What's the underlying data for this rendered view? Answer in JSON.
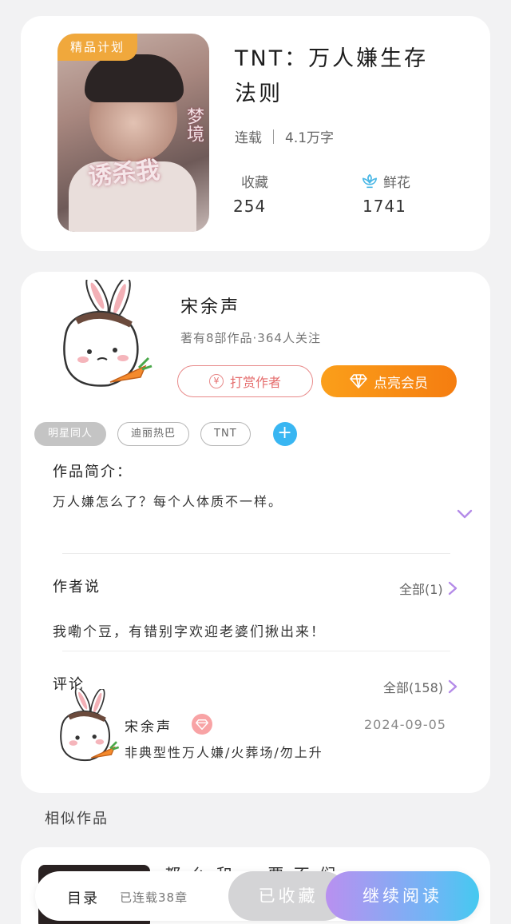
{
  "book": {
    "cover_badge": "精品计划",
    "cover_title": "诱杀我",
    "cover_subtitle": "梦境",
    "title": "TNT：万人嫌生存法则",
    "status": "连载",
    "word_count": "4.1万字",
    "favorites_label": "收藏",
    "favorites_count": "254",
    "flowers_label": "鲜花",
    "flowers_count": "1741"
  },
  "author": {
    "name": "宋余声",
    "stats": "著有8部作品·364人关注",
    "reward_label": "打赏作者",
    "vip_label": "点亮会员"
  },
  "tags": [
    "明星同人",
    "迪丽热巴",
    "TNT"
  ],
  "intro": {
    "heading": "作品简介：",
    "text": "万人嫌怎么了？每个人体质不一样。"
  },
  "author_says": {
    "heading": "作者说",
    "more": "全部(1)",
    "text": "我嘞个豆，有错别字欢迎老婆们揪出来！"
  },
  "comments": {
    "heading": "评论",
    "more": "全部(158)",
    "items": [
      {
        "user": "宋余声",
        "date": "2024-09-05",
        "text": "非典型性万人嫌/火葬场/勿上升"
      }
    ]
  },
  "similar": {
    "heading": "相似作品",
    "first_title": "都 么 和 … 要 不 们 …"
  },
  "bottom_bar": {
    "toc_label": "目录",
    "toc_status": "已连载38章",
    "favorited_label": "已收藏",
    "continue_label": "继续阅读"
  },
  "colors": {
    "accent_orange": "#f57d10",
    "reward_red": "#e56d6d",
    "tag_add_blue": "#39b6f2",
    "chevron_purple": "#b48be8"
  }
}
